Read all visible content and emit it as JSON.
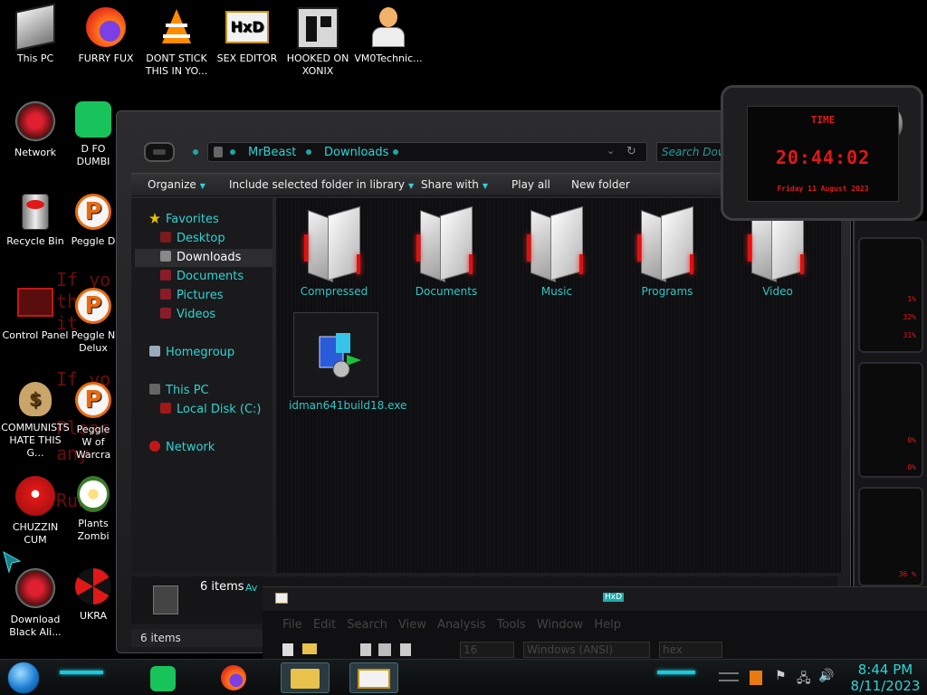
{
  "desktop_icons": [
    {
      "label": "This PC"
    },
    {
      "label": "FURRY FUX"
    },
    {
      "label": "DONT STICK THIS IN YO..."
    },
    {
      "label": "SEX EDITOR"
    },
    {
      "label": "HOOKED ON XONIX"
    },
    {
      "label": "VM0Technic..."
    },
    {
      "label": "Network"
    },
    {
      "label": "D FO DUMBI"
    },
    {
      "label": "Recycle Bin"
    },
    {
      "label": "Peggle D"
    },
    {
      "label": "Control Panel"
    },
    {
      "label": "Peggle N Delux"
    },
    {
      "label": "COMMUNISTS HATE THIS G..."
    },
    {
      "label": "Peggle W of Warcra"
    },
    {
      "label": "CHUZZIN CUM"
    },
    {
      "label": "Plants Zombi"
    },
    {
      "label": "Download Black Ali..."
    },
    {
      "label": "UKRA"
    }
  ],
  "background_text": [
    "If yo",
    "the",
    "it",
    "If yo",
    "Pleas",
    "any",
    "Run"
  ],
  "explorer": {
    "breadcrumb": [
      "MrBeast",
      "Downloads"
    ],
    "search_placeholder": "Search Downl",
    "toolbar": {
      "organize": "Organize",
      "include": "Include selected folder in library",
      "share": "Share with",
      "play_all": "Play all",
      "new_folder": "New folder"
    },
    "nav": {
      "favorites": "Favorites",
      "desktop": "Desktop",
      "downloads": "Downloads",
      "documents": "Documents",
      "pictures": "Pictures",
      "videos": "Videos",
      "homegroup": "Homegroup",
      "this_pc": "This PC",
      "local_disk": "Local Disk (C:)",
      "network": "Network"
    },
    "folders": [
      "Compressed",
      "Documents",
      "Music",
      "Programs",
      "Video"
    ],
    "file": "idman641build18.exe",
    "details_count": "6 items",
    "details_extra": "Av",
    "status": "6 items"
  },
  "clock_gadget": {
    "label": "TIME",
    "time": "20:44:02",
    "date": "Friday 11 August 2023"
  },
  "sys_gadget": {
    "values": [
      "1%",
      "32%",
      "31%",
      "0%",
      "0%",
      "36 %"
    ]
  },
  "hex_editor": {
    "title": "HxD",
    "menu": [
      "File",
      "Edit",
      "Search",
      "View",
      "Analysis",
      "Tools",
      "Window",
      "Help"
    ],
    "bytes_per_row": "16",
    "charset": "Windows (ANSI)",
    "mode": "hex"
  },
  "taskbar": {
    "time": "8:44 PM",
    "date": "8/11/2023"
  }
}
